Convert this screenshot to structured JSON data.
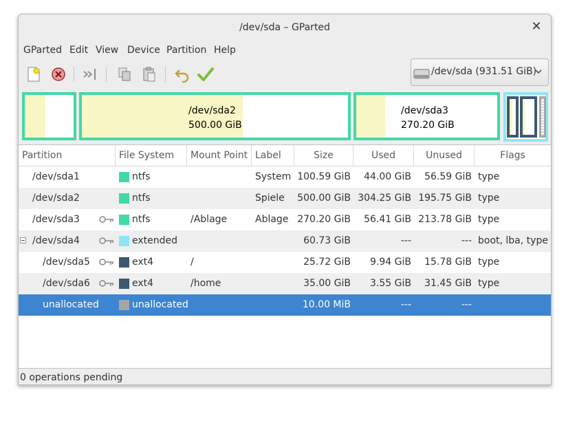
{
  "window": {
    "title": "/dev/sda – GParted"
  },
  "menu": [
    "GParted",
    "Edit",
    "View",
    "Device",
    "Partition",
    "Help"
  ],
  "toolbar": {
    "icons": [
      "new-icon",
      "delete-icon",
      "resize-move-icon",
      "copy-icon",
      "paste-icon",
      "undo-icon",
      "apply-icon"
    ]
  },
  "device": {
    "label": "/dev/sda  (931.51 GiB)"
  },
  "diskmap": {
    "sda2": {
      "name": "/dev/sda2",
      "size": "500.00 GiB"
    },
    "sda3": {
      "name": "/dev/sda3",
      "size": "270.20 GiB"
    }
  },
  "columns": [
    "Partition",
    "File System",
    "Mount Point",
    "Label",
    "Size",
    "Used",
    "Unused",
    "Flags"
  ],
  "rows": [
    {
      "partition": "/dev/sda1",
      "fs": "ntfs",
      "mount": "",
      "label": "System",
      "size": "100.59 GiB",
      "used": "44.00 GiB",
      "unused": "56.59 GiB",
      "flags": "type"
    },
    {
      "partition": "/dev/sda2",
      "fs": "ntfs",
      "mount": "",
      "label": "Spiele",
      "size": "500.00 GiB",
      "used": "304.25 GiB",
      "unused": "195.75 GiB",
      "flags": "type"
    },
    {
      "partition": "/dev/sda3",
      "fs": "ntfs",
      "mount": "/Ablage",
      "label": "Ablage",
      "size": "270.20 GiB",
      "used": "56.41 GiB",
      "unused": "213.78 GiB",
      "flags": "type"
    },
    {
      "partition": "/dev/sda4",
      "fs": "extended",
      "mount": "",
      "label": "",
      "size": "60.73 GiB",
      "used": "---",
      "unused": "---",
      "flags": "boot, lba, type"
    },
    {
      "partition": "/dev/sda5",
      "fs": "ext4",
      "mount": "/",
      "label": "",
      "size": "25.72 GiB",
      "used": "9.94 GiB",
      "unused": "15.78 GiB",
      "flags": "type"
    },
    {
      "partition": "/dev/sda6",
      "fs": "ext4",
      "mount": "/home",
      "label": "",
      "size": "35.00 GiB",
      "used": "3.55 GiB",
      "unused": "31.45 GiB",
      "flags": "type"
    },
    {
      "partition": "unallocated",
      "fs": "unallocated",
      "mount": "",
      "label": "",
      "size": "10.00 MiB",
      "used": "---",
      "unused": "---",
      "flags": ""
    }
  ],
  "colors": {
    "ntfs": "#43d8a8",
    "extended": "#8ee6f4",
    "ext4": "#3e5870",
    "unallocated": "#a6a6a6",
    "selection": "#3d85d0",
    "used": "#f7f6c4"
  },
  "status": {
    "text": "0 operations pending"
  }
}
